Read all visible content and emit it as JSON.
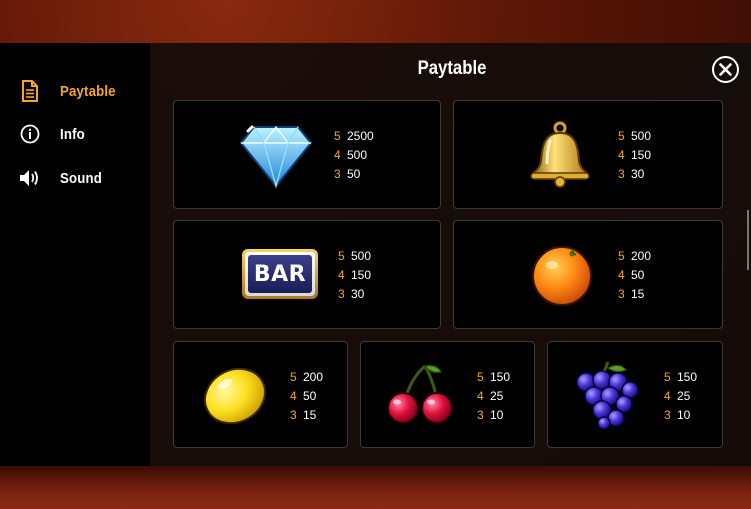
{
  "title": "Paytable",
  "nav": [
    {
      "label": "Paytable",
      "icon": "document-icon",
      "active": true
    },
    {
      "label": "Info",
      "icon": "info-icon",
      "active": false
    },
    {
      "label": "Sound",
      "icon": "speaker-icon",
      "active": false
    }
  ],
  "colors": {
    "accent": "#f5a623",
    "card_bg": "#000000",
    "panel_bg": "#121212"
  },
  "symbols": [
    {
      "name": "diamond",
      "pays": [
        {
          "count": "5",
          "value": "2500"
        },
        {
          "count": "4",
          "value": "500"
        },
        {
          "count": "3",
          "value": "50"
        }
      ]
    },
    {
      "name": "bell",
      "pays": [
        {
          "count": "5",
          "value": "500"
        },
        {
          "count": "4",
          "value": "150"
        },
        {
          "count": "3",
          "value": "30"
        }
      ]
    },
    {
      "name": "bar",
      "label": "BAR",
      "pays": [
        {
          "count": "5",
          "value": "500"
        },
        {
          "count": "4",
          "value": "150"
        },
        {
          "count": "3",
          "value": "30"
        }
      ]
    },
    {
      "name": "orange",
      "pays": [
        {
          "count": "5",
          "value": "200"
        },
        {
          "count": "4",
          "value": "50"
        },
        {
          "count": "3",
          "value": "15"
        }
      ]
    },
    {
      "name": "lemon",
      "pays": [
        {
          "count": "5",
          "value": "200"
        },
        {
          "count": "4",
          "value": "50"
        },
        {
          "count": "3",
          "value": "15"
        }
      ]
    },
    {
      "name": "cherry",
      "pays": [
        {
          "count": "5",
          "value": "150"
        },
        {
          "count": "4",
          "value": "25"
        },
        {
          "count": "3",
          "value": "10"
        }
      ]
    },
    {
      "name": "grapes",
      "pays": [
        {
          "count": "5",
          "value": "150"
        },
        {
          "count": "4",
          "value": "25"
        },
        {
          "count": "3",
          "value": "10"
        }
      ]
    }
  ]
}
